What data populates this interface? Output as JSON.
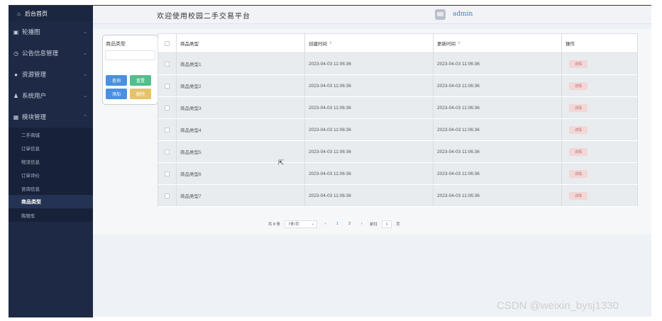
{
  "sidebar": {
    "home": "后台首页",
    "items": [
      {
        "label": "轮播图",
        "icon": "image-icon"
      },
      {
        "label": "公告信息管理",
        "icon": "clock-icon"
      },
      {
        "label": "资源管理",
        "icon": "pin-icon"
      },
      {
        "label": "系统用户",
        "icon": "user-icon"
      },
      {
        "label": "模块管理",
        "icon": "grid-icon"
      }
    ],
    "subitems": [
      "二手商城",
      "订单信息",
      "物流信息",
      "订单评价",
      "咨询信息",
      "商品类型",
      "购物车"
    ],
    "active_subitem": "商品类型"
  },
  "header": {
    "welcome": "欢迎使用校园二手交易平台",
    "username": "admin"
  },
  "search": {
    "label": "商品类型",
    "placeholder": "",
    "buttons": {
      "query": "查询",
      "reset": "重置",
      "add": "添加",
      "delete": "删除"
    }
  },
  "table": {
    "columns": [
      "商品类型",
      "创建时间",
      "更新时间",
      "操作"
    ],
    "rows": [
      {
        "type": "商品类型1",
        "created": "2023-04-03 11:06:36",
        "updated": "2023-04-03 11:06:36",
        "action": "详情"
      },
      {
        "type": "商品类型2",
        "created": "2023-04-03 11:06:36",
        "updated": "2023-04-03 11:06:36",
        "action": "详情"
      },
      {
        "type": "商品类型3",
        "created": "2023-04-03 11:06:36",
        "updated": "2023-04-03 11:06:36",
        "action": "详情"
      },
      {
        "type": "商品类型4",
        "created": "2023-04-03 11:06:36",
        "updated": "2023-04-03 11:06:36",
        "action": "详情"
      },
      {
        "type": "商品类型5",
        "created": "2023-04-03 11:06:36",
        "updated": "2023-04-03 11:06:36",
        "action": "详情"
      },
      {
        "type": "商品类型6",
        "created": "2023-04-03 11:06:36",
        "updated": "2023-04-03 11:06:36",
        "action": "详情"
      },
      {
        "type": "商品类型7",
        "created": "2023-04-03 11:06:36",
        "updated": "2023-04-03 11:06:36",
        "action": "详情"
      }
    ]
  },
  "pagination": {
    "total": "共 8 条",
    "page_size": "7条/页",
    "pages": [
      "1",
      "2"
    ],
    "current_page": "1",
    "goto_label": "前往",
    "goto_value": "1",
    "page_suffix": "页"
  },
  "watermark": "CSDN @weixin_bysj1330"
}
